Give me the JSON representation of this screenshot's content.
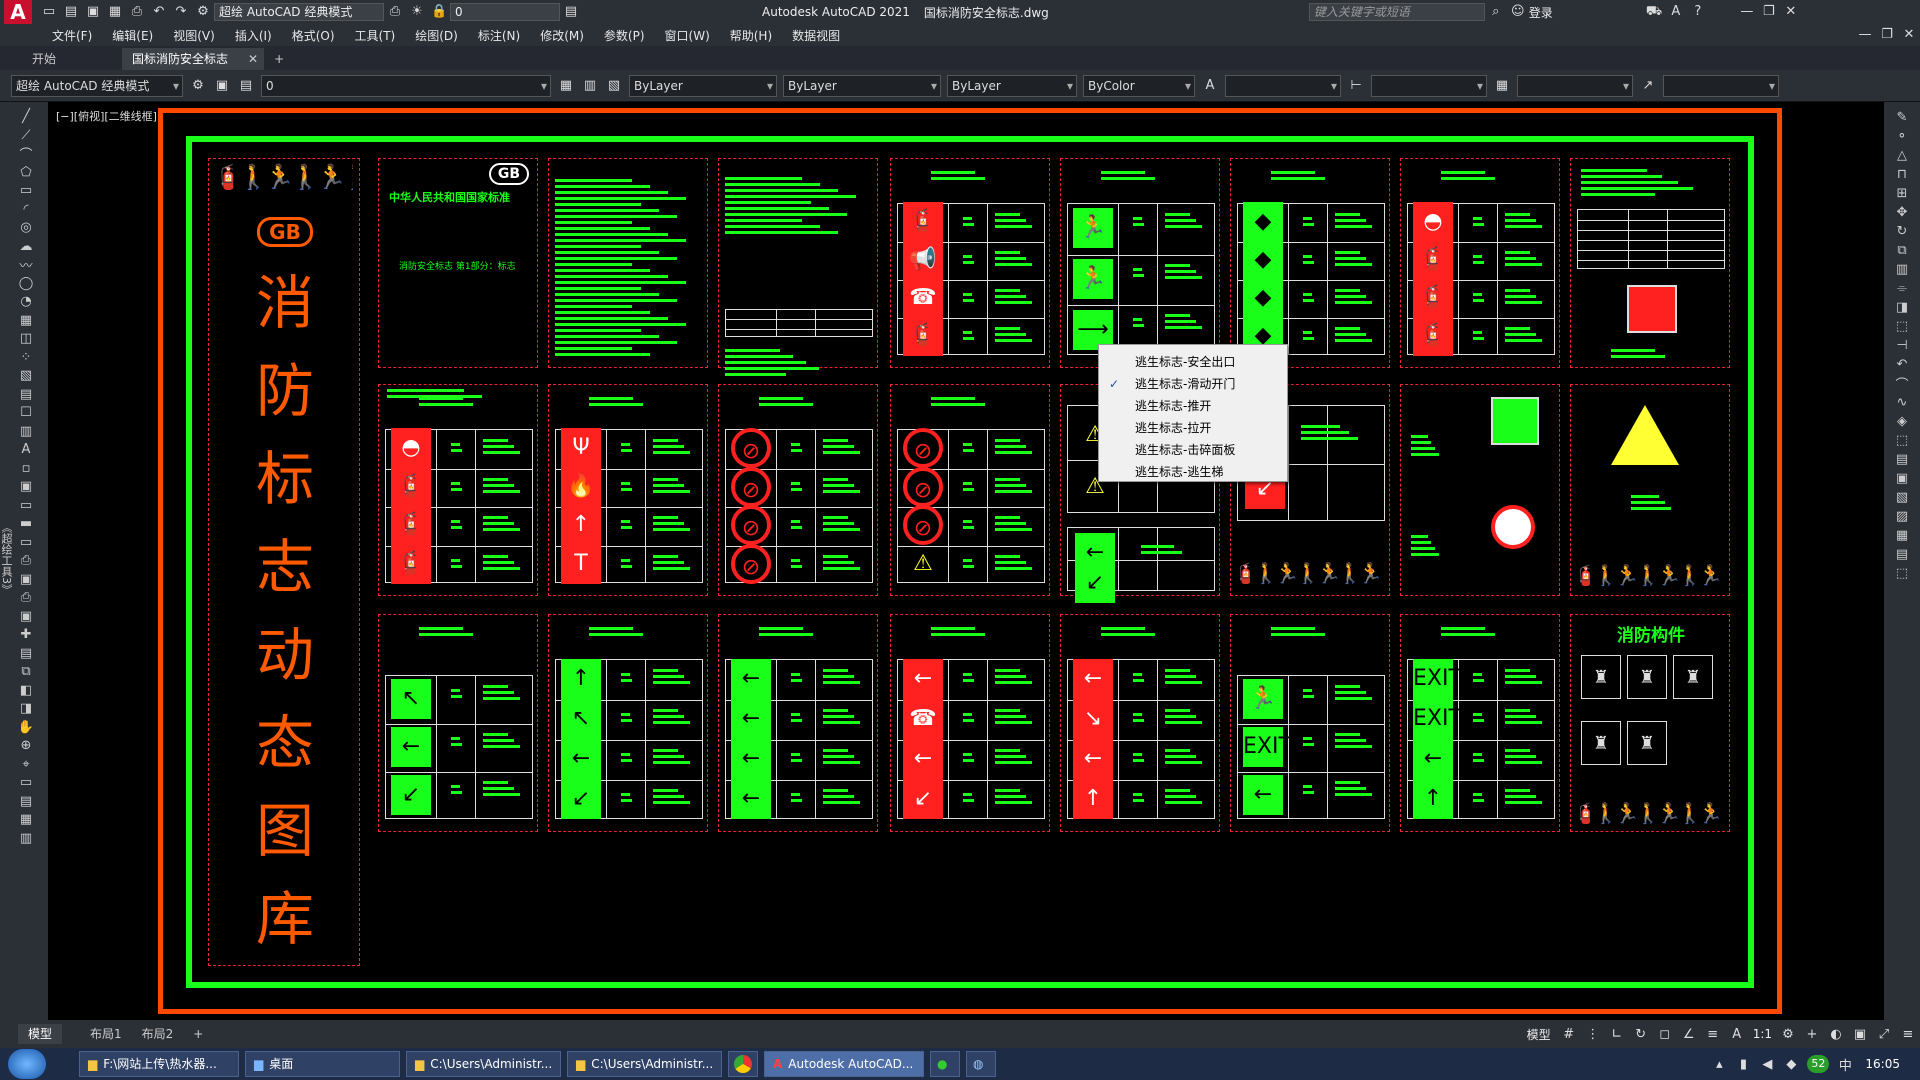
{
  "app": {
    "title": "Autodesk AutoCAD 2021",
    "file": "国标消防安全标志.dwg",
    "workspace": "超绘 AutoCAD 经典模式",
    "layer_quick": "0",
    "search_placeholder": "键入关键字或短语",
    "login": "登录",
    "logo": "A"
  },
  "menu": [
    "文件(F)",
    "编辑(E)",
    "视图(V)",
    "插入(I)",
    "格式(O)",
    "工具(T)",
    "绘图(D)",
    "标注(N)",
    "修改(M)",
    "参数(P)",
    "窗口(W)",
    "帮助(H)",
    "数据视图"
  ],
  "tabs": [
    {
      "label": "开始"
    },
    {
      "label": "国标消防安全标志*"
    }
  ],
  "props": {
    "workspace": "超绘 AutoCAD 经典模式",
    "layer": "0",
    "color": "ByLayer",
    "linetype": "ByLayer",
    "lineweight": "ByLayer",
    "plotstyle": "ByColor"
  },
  "viewport_label": "[−][俯视][二维线框]",
  "left_palette_label": "《超绘工具3》",
  "drawing": {
    "title_chars": [
      "消",
      "防",
      "标",
      "志",
      "动",
      "态",
      "图",
      "库"
    ],
    "gb": "GB",
    "doc_header": "中华人民共和国国家标准",
    "doc_sub": "消防安全标志 第1部分：标志",
    "panel_title": "消防构件"
  },
  "context_menu": {
    "items": [
      {
        "label": "逃生标志-安全出口",
        "checked": false
      },
      {
        "label": "逃生标志-滑动开门",
        "checked": true
      },
      {
        "label": "逃生标志-推开",
        "checked": false
      },
      {
        "label": "逃生标志-拉开",
        "checked": false
      },
      {
        "label": "逃生标志-击碎面板",
        "checked": false
      },
      {
        "label": "逃生标志-逃生梯",
        "checked": false
      }
    ],
    "check": "✓"
  },
  "layout_tabs": [
    "模型",
    "布局1",
    "布局2"
  ],
  "status": {
    "model": "模型",
    "scale": "1:1"
  },
  "taskbar": {
    "items": [
      {
        "label": "F:\\网站上传\\热水器..."
      },
      {
        "label": "桌面"
      },
      {
        "label": "C:\\Users\\Administr..."
      },
      {
        "label": "C:\\Users\\Administr..."
      },
      {
        "label": "Autodesk AutoCAD..."
      }
    ],
    "clock": "16:05",
    "badge": "52"
  },
  "colors": {
    "green": "#19ff19",
    "red": "#ff2020",
    "orange": "#ff5a00",
    "yellow": "#ffff33",
    "dash": "#e02020"
  }
}
